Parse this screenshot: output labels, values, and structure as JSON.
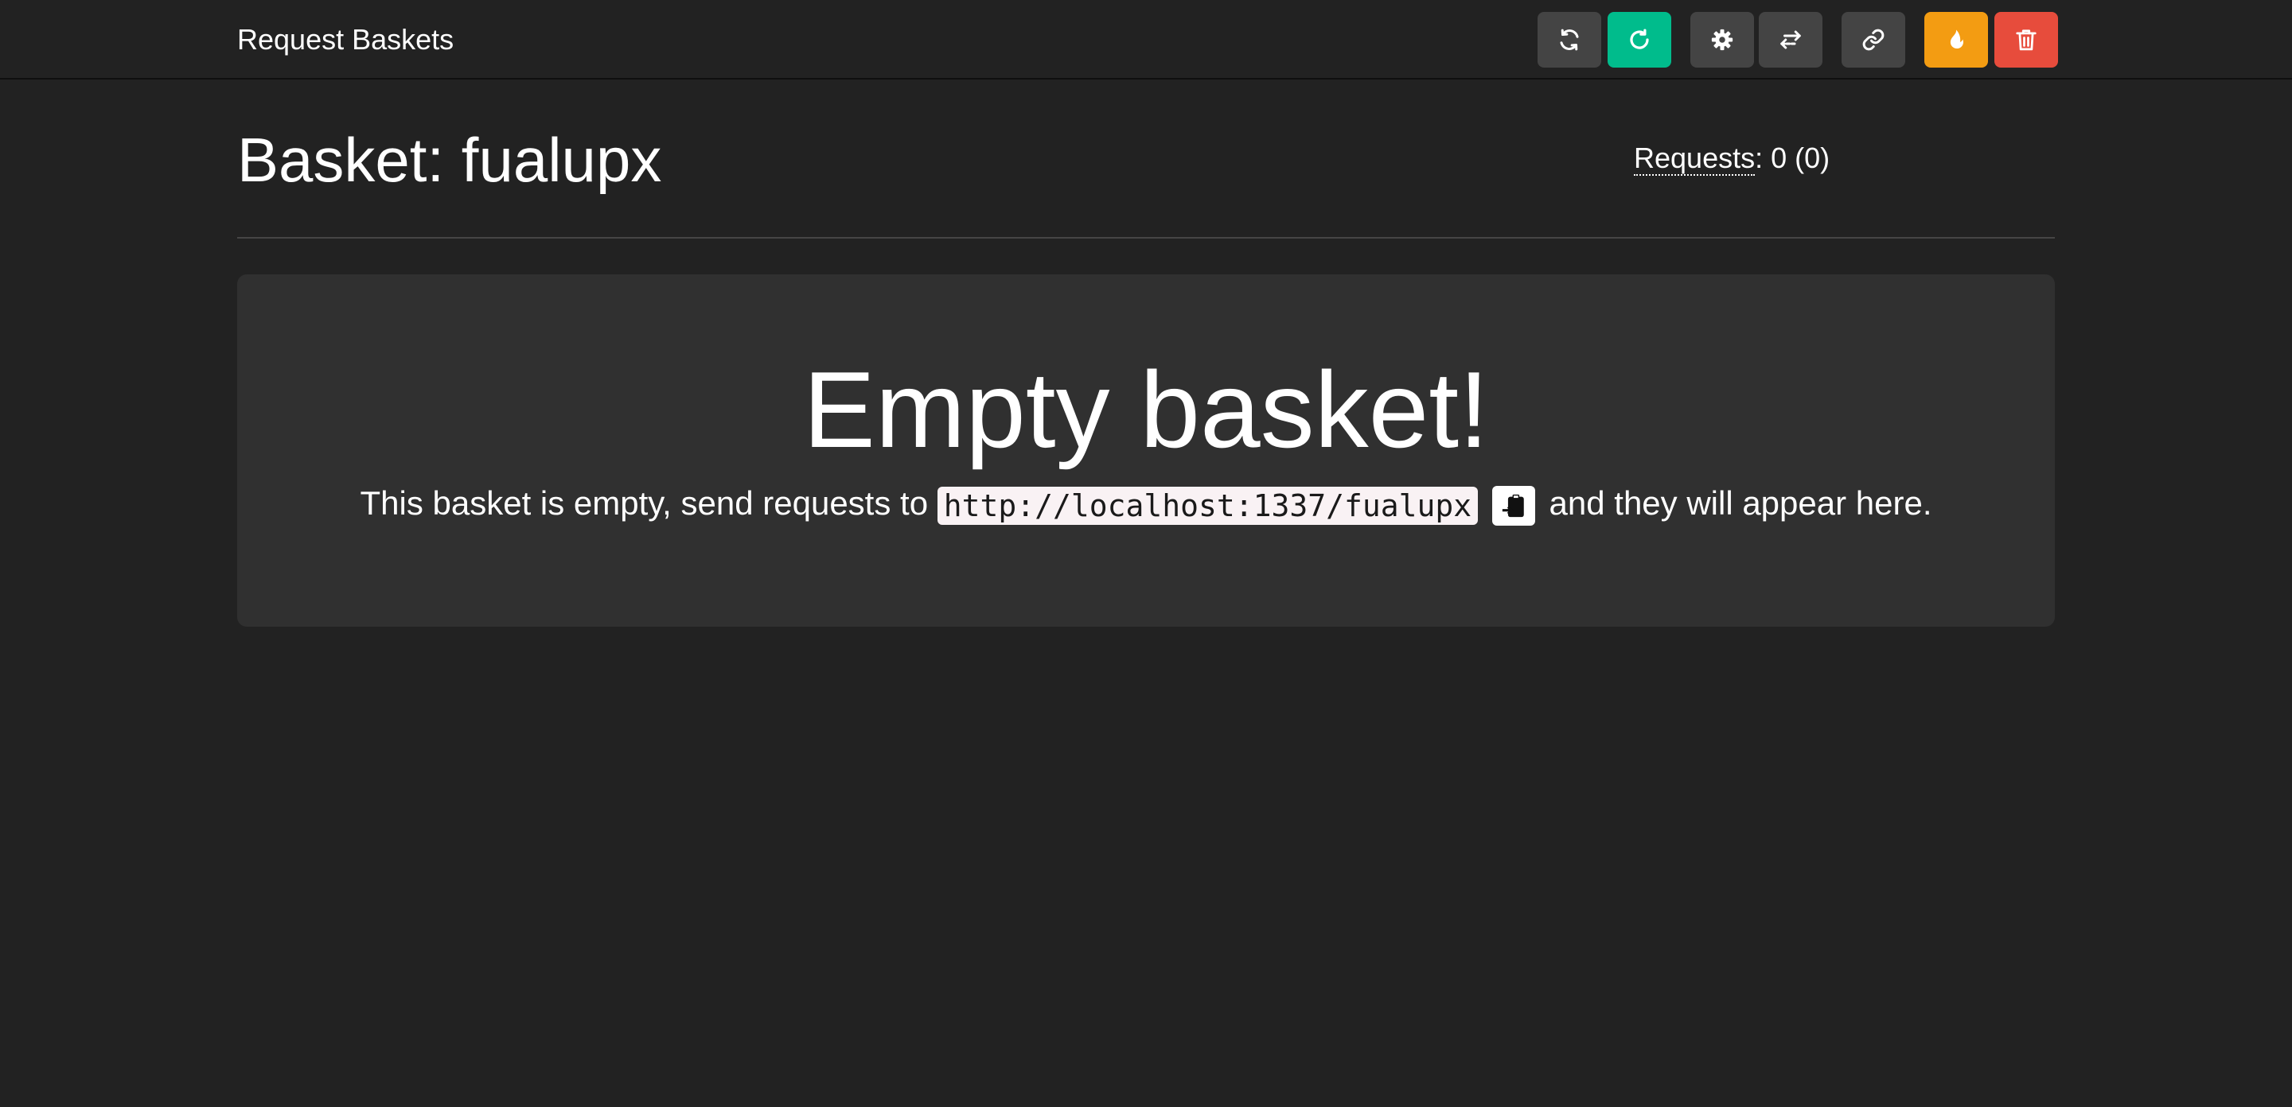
{
  "navbar": {
    "brand": "Request Baskets",
    "buttons": [
      {
        "name": "refresh-button",
        "icon": "refresh-icon",
        "color": "#444444"
      },
      {
        "name": "auto-refresh-button",
        "icon": "rotate-right-icon",
        "color": "#00bc8c"
      },
      {
        "name": "settings-button",
        "icon": "gear-icon",
        "color": "#444444"
      },
      {
        "name": "responses-button",
        "icon": "exchange-icon",
        "color": "#444444"
      },
      {
        "name": "share-button",
        "icon": "link-icon",
        "color": "#444444"
      },
      {
        "name": "destroy-button",
        "icon": "fire-icon",
        "color": "#f39c12"
      },
      {
        "name": "delete-button",
        "icon": "trash-icon",
        "color": "#e74c3c"
      }
    ]
  },
  "basket": {
    "title": "Basket: fualupx",
    "requests_label": "Requests",
    "requests_count": ": 0 (0)"
  },
  "empty": {
    "title": "Empty basket!",
    "text_before": "This basket is empty, send requests to ",
    "url": "http://localhost:1337/fualupx",
    "copy_icon": "clipboard-icon",
    "text_after": " and they will appear here."
  },
  "colors": {
    "background": "#222222",
    "panel": "#303030",
    "success": "#00bc8c",
    "warning": "#f39c12",
    "danger": "#e74c3c",
    "default": "#444444"
  }
}
